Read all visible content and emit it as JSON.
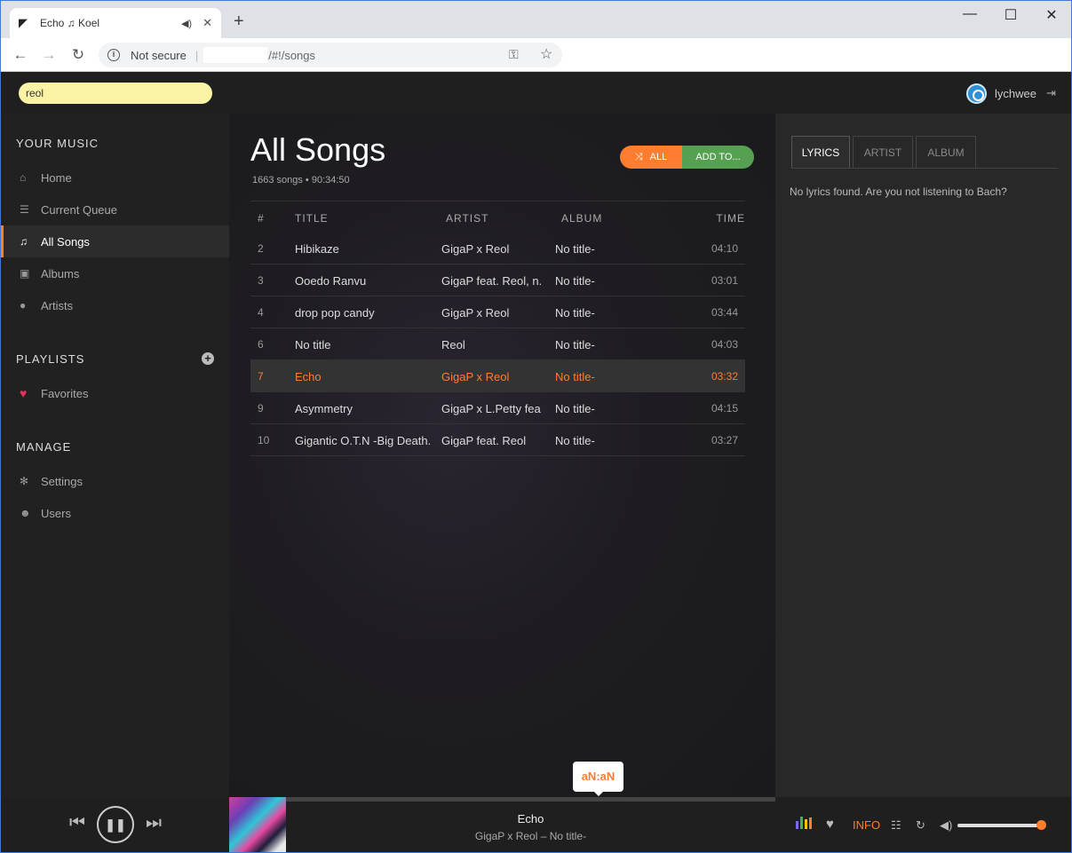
{
  "browser": {
    "tab_title": "Echo ♫ Koel",
    "new_tab": "+",
    "window_controls": {
      "minimize": "—",
      "maximize": "☐",
      "close": "✕"
    },
    "security_label": "Not secure",
    "url_path": "/#!/songs"
  },
  "header": {
    "search_value": "reol",
    "username": "lychwee"
  },
  "sidebar": {
    "your_music_title": "YOUR MUSIC",
    "music_items": [
      {
        "label": "Home",
        "icon": "home-icon"
      },
      {
        "label": "Current Queue",
        "icon": "list-icon"
      },
      {
        "label": "All Songs",
        "icon": "music-note-icon",
        "active": true
      },
      {
        "label": "Albums",
        "icon": "album-icon"
      },
      {
        "label": "Artists",
        "icon": "microphone-icon"
      }
    ],
    "playlists_title": "PLAYLISTS",
    "playlist_items": [
      {
        "label": "Favorites",
        "icon": "heart-icon"
      }
    ],
    "manage_title": "MANAGE",
    "manage_items": [
      {
        "label": "Settings",
        "icon": "gear-icon"
      },
      {
        "label": "Users",
        "icon": "users-icon"
      }
    ]
  },
  "main": {
    "title": "All Songs",
    "meta": "1663 songs • 90:34:50",
    "shuffle_all_label": "ALL",
    "add_to_label": "ADD TO...",
    "columns": [
      "#",
      "TITLE",
      "ARTIST",
      "ALBUM",
      "TIME"
    ],
    "songs": [
      {
        "no": "2",
        "title": "Hibikaze",
        "artist": "GigaP x Reol",
        "album": "No title-",
        "time": "04:10"
      },
      {
        "no": "3",
        "title": "Ooedo Ranvu",
        "artist": "GigaP feat. Reol, n...",
        "album": "No title-",
        "time": "03:01"
      },
      {
        "no": "4",
        "title": "drop pop candy",
        "artist": "GigaP x Reol",
        "album": "No title-",
        "time": "03:44"
      },
      {
        "no": "6",
        "title": "No title",
        "artist": "Reol",
        "album": "No title-",
        "time": "04:03"
      },
      {
        "no": "7",
        "title": "Echo",
        "artist": "GigaP x Reol",
        "album": "No title-",
        "time": "03:32",
        "playing": true
      },
      {
        "no": "9",
        "title": "Asymmetry",
        "artist": "GigaP x L.Petty fea...",
        "album": "No title-",
        "time": "04:15"
      },
      {
        "no": "10",
        "title": "Gigantic O.T.N -Big Death...",
        "artist": "GigaP feat. Reol",
        "album": "No title-",
        "time": "03:27"
      }
    ]
  },
  "right_panel": {
    "tabs": [
      "LYRICS",
      "ARTIST",
      "ALBUM"
    ],
    "active_tab": "LYRICS",
    "lyrics_text": "No lyrics found. Are you not listening to Bach?"
  },
  "player": {
    "track_title": "Echo",
    "track_sub": "GigaP x Reol – No title-",
    "time_tooltip": "aN:aN",
    "info_label": "INFO",
    "volume": 0.95,
    "accent_color": "#ff7d2e",
    "add_color": "#56a052"
  }
}
